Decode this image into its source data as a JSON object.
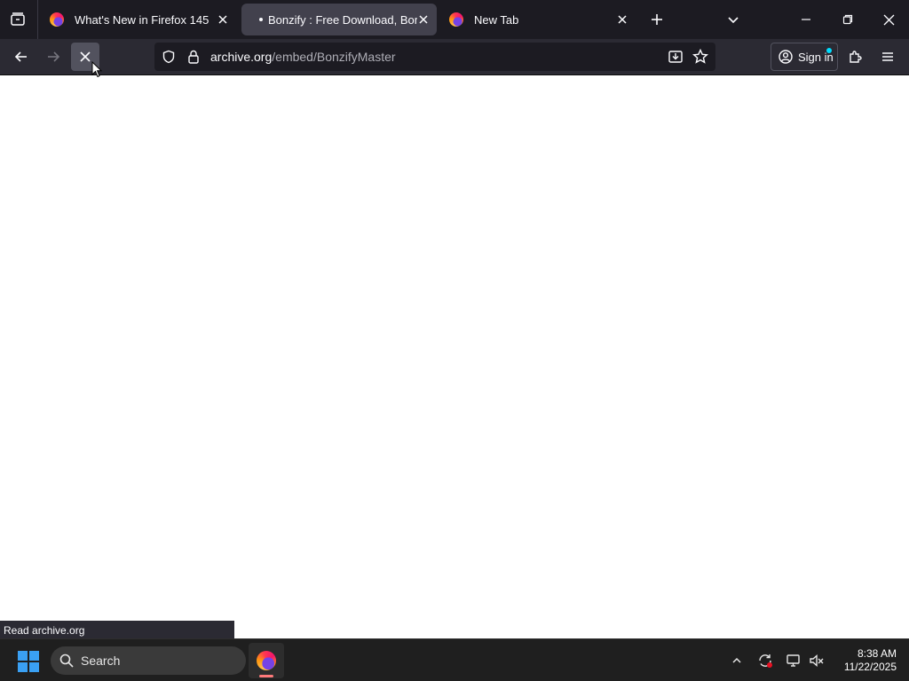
{
  "tabs": [
    {
      "title": "What's New in Firefox 145",
      "favicon": "firefox-icon",
      "active": false
    },
    {
      "title": "Bonzify : Free Download, Borrow",
      "favicon": "loading-dot",
      "active": true
    },
    {
      "title": "New Tab",
      "favicon": "firefox-icon",
      "active": false
    }
  ],
  "nav": {
    "url_domain": "archive.org",
    "url_path": "/embed/BonzifyMaster",
    "sign_in_label": "Sign in"
  },
  "status": {
    "text": "Read archive.org"
  },
  "taskbar": {
    "search_label": "Search",
    "time": "8:38 AM",
    "date": "11/22/2025"
  },
  "colors": {
    "tabstrip": "#1c1b22",
    "toolbar": "#2b2a33",
    "urlbar": "#1c1b22",
    "active_tab": "#42414d",
    "taskbar": "#1f1f1f",
    "accent": "#00ddff"
  }
}
